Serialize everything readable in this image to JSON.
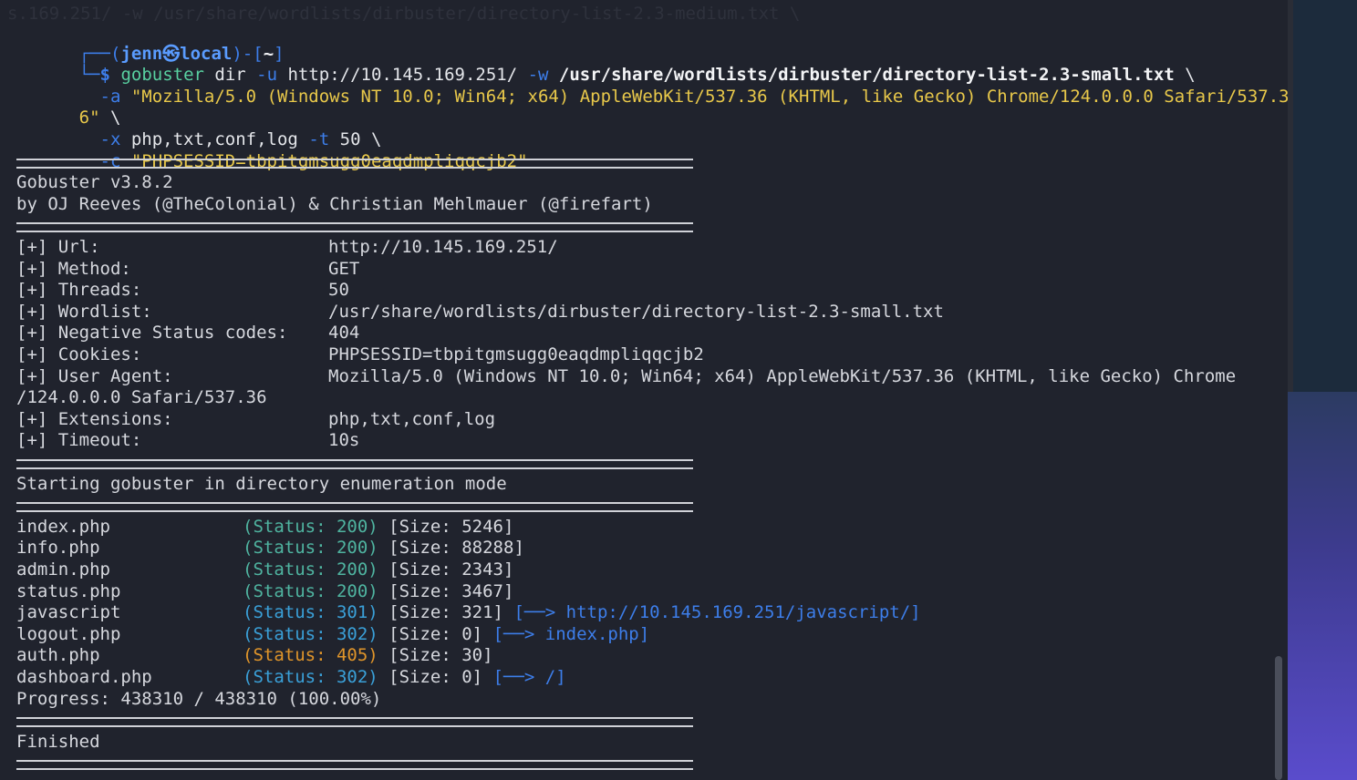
{
  "prompt": {
    "frame_top": "┌──(",
    "user": "jenn㉿local",
    "frame_mid": ")-[",
    "cwd": "~",
    "frame_end": "]",
    "frame_bottom": "└─",
    "dollar": "$"
  },
  "command": {
    "tool": "gobuster",
    "line1_a": " dir ",
    "flag_u": "-u",
    "url": " http://10.145.169.251/ ",
    "flag_w": "-w",
    "wordlist": " /usr/share/wordlists/dirbuster/directory-list-2.3-small.txt",
    "cont": " \\",
    "flag_a": "  -a ",
    "ua_str": "\"Mozilla/5.0 (Windows NT 10.0; Win64; x64) AppleWebKit/537.36 (KHTML, like Gecko) Chrome/124.0.0.0 Safari/537.3",
    "ua_wrap": "6\"",
    "flag_x": "  -x ",
    "ext": "php,txt,conf,log ",
    "flag_t": "-t",
    "threads_arg": " 50 \\",
    "flag_c": "  -c ",
    "cookie_str": "\"PHPSESSID=tbpitgmsugg0eaqdmpliqqcjb2\""
  },
  "banner": {
    "version": "Gobuster v3.8.2",
    "authors": "by OJ Reeves (@TheColonial) & Christian Mehlmauer (@firefart)"
  },
  "config": [
    {
      "key": "[+] Url:",
      "value": "http://10.145.169.251/"
    },
    {
      "key": "[+] Method:",
      "value": "GET"
    },
    {
      "key": "[+] Threads:",
      "value": "50"
    },
    {
      "key": "[+] Wordlist:",
      "value": "/usr/share/wordlists/dirbuster/directory-list-2.3-small.txt"
    },
    {
      "key": "[+] Negative Status codes:",
      "value": "404"
    },
    {
      "key": "[+] Cookies:",
      "value": "PHPSESSID=tbpitgmsugg0eaqdmpliqqcjb2"
    },
    {
      "key": "[+] User Agent:",
      "value": "Mozilla/5.0 (Windows NT 10.0; Win64; x64) AppleWebKit/537.36 (KHTML, like Gecko) Chrome"
    },
    {
      "key": "",
      "value": ""
    },
    {
      "key": "[+] Extensions:",
      "value": "php,txt,conf,log"
    },
    {
      "key": "[+] Timeout:",
      "value": "10s"
    }
  ],
  "ua_wrap_line": "/124.0.0.0 Safari/537.36",
  "mode_msg": "Starting gobuster in directory enumeration mode",
  "results": [
    {
      "path": "index.php",
      "status": "(Status: 200)",
      "size": "[Size: 5246]",
      "redirect": "",
      "kind": "ok"
    },
    {
      "path": "info.php",
      "status": "(Status: 200)",
      "size": "[Size: 88288]",
      "redirect": "",
      "kind": "ok"
    },
    {
      "path": "admin.php",
      "status": "(Status: 200)",
      "size": "[Size: 2343]",
      "redirect": "",
      "kind": "ok"
    },
    {
      "path": "status.php",
      "status": "(Status: 200)",
      "size": "[Size: 3467]",
      "redirect": "",
      "kind": "ok"
    },
    {
      "path": "javascript",
      "status": "(Status: 301)",
      "size": "[Size: 321]",
      "redirect": "[──> http://10.145.169.251/javascript/]",
      "kind": "redir"
    },
    {
      "path": "logout.php",
      "status": "(Status: 302)",
      "size": "[Size: 0]",
      "redirect": "[──> index.php]",
      "kind": "redir"
    },
    {
      "path": "auth.php",
      "status": "(Status: 405)",
      "size": "[Size: 30]",
      "redirect": "",
      "kind": "err"
    },
    {
      "path": "dashboard.php",
      "status": "(Status: 302)",
      "size": "[Size: 0]",
      "redirect": "[──> /]",
      "kind": "redir"
    }
  ],
  "progress": "Progress: 438310 / 438310 (100.00%)",
  "finished": "Finished",
  "ghost_text": "s.169.251/ -w /usr/share/wordlists/dirbuster/directory-list-2.3-medium.txt \\",
  "colors": {
    "background": "#20232d",
    "prompt": "#3d7eea",
    "string": "#e8c84a",
    "status_ok": "#4fb4a0",
    "status_redirect": "#3aa0d8",
    "status_error": "#e0952a"
  }
}
